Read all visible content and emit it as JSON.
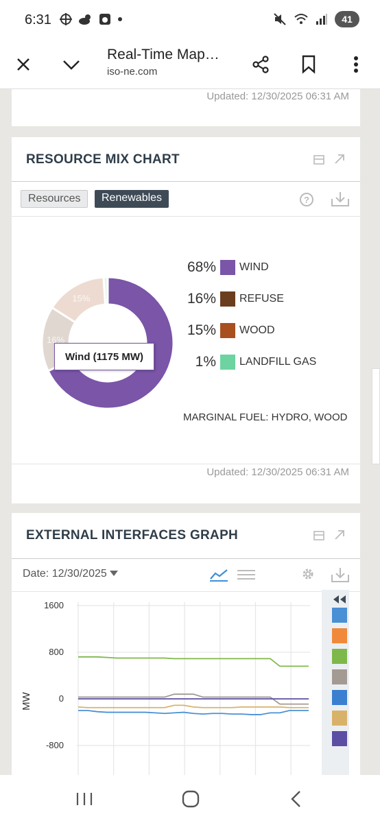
{
  "status_bar": {
    "time": "6:31",
    "battery": "41"
  },
  "browser": {
    "title": "Real-Time Map…",
    "url": "iso-ne.com"
  },
  "prev_card": {
    "updated": "Updated: 12/30/2025 06:31 AM"
  },
  "resource_mix": {
    "title": "RESOURCE MIX CHART",
    "tabs": [
      "Resources",
      "Renewables"
    ],
    "active_tab": "Renewables",
    "tooltip": "Wind (1175 MW)",
    "marginal_fuel": "MARGINAL FUEL: HYDRO, WOOD",
    "updated": "Updated: 12/30/2025 06:31 AM"
  },
  "external_interfaces": {
    "title": "EXTERNAL INTERFACES GRAPH",
    "date": "Date: 12/30/2025",
    "series_colors": [
      "#4a90d4",
      "#f08a3a",
      "#7fb84a",
      "#a39a93",
      "#3a7fd0",
      "#d9b26a",
      "#5b4ea3"
    ]
  },
  "chart_data": [
    {
      "type": "pie",
      "categories": [
        "WIND",
        "REFUSE",
        "WOOD",
        "LANDFILL GAS"
      ],
      "values": [
        68,
        16,
        15,
        1
      ],
      "labels": [
        "68%",
        "16%",
        "15%",
        "1%"
      ],
      "colors": [
        "#7a55a8",
        "#6b3e1e",
        "#a8501f",
        "#6dd3a0"
      ]
    },
    {
      "type": "line",
      "ylabel": "MW",
      "ylim": [
        -800,
        1600
      ],
      "yticks": [
        "1600",
        "800",
        "0",
        "-800"
      ],
      "x": [
        0,
        1,
        2,
        3,
        4,
        5,
        6,
        7,
        8,
        9,
        10,
        11,
        12,
        13,
        14,
        15,
        16,
        17,
        18,
        19,
        20,
        21,
        22,
        23,
        24
      ],
      "series": [
        {
          "color": "#7fb84a",
          "values": [
            720,
            720,
            720,
            710,
            700,
            700,
            700,
            700,
            700,
            700,
            690,
            690,
            690,
            690,
            690,
            690,
            690,
            690,
            690,
            690,
            690,
            560,
            560,
            560,
            560
          ]
        },
        {
          "color": "#a39a93",
          "values": [
            30,
            30,
            30,
            30,
            30,
            30,
            30,
            30,
            30,
            30,
            80,
            80,
            80,
            30,
            30,
            30,
            30,
            30,
            30,
            30,
            30,
            -90,
            -90,
            -90,
            -90
          ]
        },
        {
          "color": "#5b4ea3",
          "values": [
            0,
            0,
            0,
            0,
            0,
            0,
            0,
            0,
            0,
            0,
            0,
            0,
            0,
            0,
            0,
            0,
            0,
            0,
            0,
            0,
            0,
            0,
            0,
            0,
            0
          ]
        },
        {
          "color": "#d9b26a",
          "values": [
            -140,
            -150,
            -150,
            -150,
            -150,
            -150,
            -150,
            -150,
            -150,
            -150,
            -110,
            -110,
            -140,
            -150,
            -150,
            -150,
            -150,
            -140,
            -140,
            -140,
            -140,
            -140,
            -150,
            -150,
            -150
          ]
        },
        {
          "color": "#4a90d4",
          "values": [
            -200,
            -200,
            -220,
            -230,
            -230,
            -230,
            -230,
            -230,
            -240,
            -250,
            -240,
            -230,
            -250,
            -260,
            -250,
            -250,
            -260,
            -260,
            -270,
            -270,
            -240,
            -240,
            -200,
            -200,
            -200
          ]
        }
      ]
    }
  ]
}
